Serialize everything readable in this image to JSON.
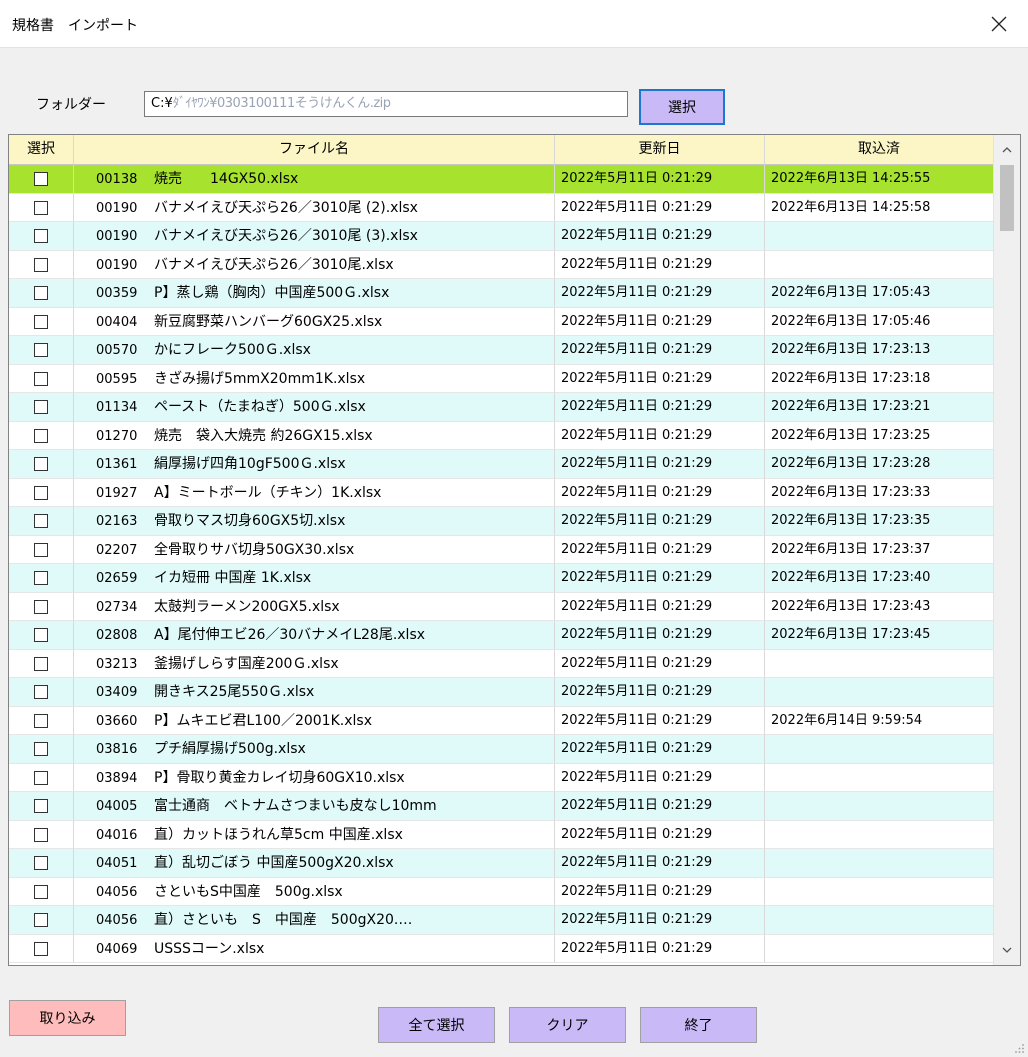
{
  "window": {
    "title": "規格書　インポート"
  },
  "folder": {
    "label": "フォルダー",
    "value_prefix": "C:¥",
    "value_rest": "ﾀﾞｲﾔﾜﾝ¥0303100111そうけんくん.zip",
    "select_label": "選択"
  },
  "grid": {
    "columns": [
      "選択",
      "ファイル名",
      "更新日",
      "取込済"
    ],
    "rows": [
      {
        "code": "00138",
        "name": "焼売　　14GX50.xlsx",
        "updated": "2022年5月11日  0:21:29",
        "imported": "2022年6月13日  14:25:55",
        "style": "sel"
      },
      {
        "code": "00190",
        "name": "バナメイえび天ぷら26／3010尾 (2).xlsx",
        "updated": "2022年5月11日  0:21:29",
        "imported": "2022年6月13日  14:25:58",
        "style": "white"
      },
      {
        "code": "00190",
        "name": "バナメイえび天ぷら26／3010尾 (3).xlsx",
        "updated": "2022年5月11日  0:21:29",
        "imported": "",
        "style": "alt"
      },
      {
        "code": "00190",
        "name": "バナメイえび天ぷら26／3010尾.xlsx",
        "updated": "2022年5月11日  0:21:29",
        "imported": "",
        "style": "white"
      },
      {
        "code": "00359",
        "name": "P】蒸し鶏（胸肉）中国産500Ｇ.xlsx",
        "updated": "2022年5月11日  0:21:29",
        "imported": "2022年6月13日  17:05:43",
        "style": "alt"
      },
      {
        "code": "00404",
        "name": "新豆腐野菜ハンバーグ60GX25.xlsx",
        "updated": "2022年5月11日  0:21:29",
        "imported": "2022年6月13日  17:05:46",
        "style": "white"
      },
      {
        "code": "00570",
        "name": "かにフレーク500Ｇ.xlsx",
        "updated": "2022年5月11日  0:21:29",
        "imported": "2022年6月13日  17:23:13",
        "style": "alt"
      },
      {
        "code": "00595",
        "name": "きざみ揚げ5mmX20mm1K.xlsx",
        "updated": "2022年5月11日  0:21:29",
        "imported": "2022年6月13日  17:23:18",
        "style": "white"
      },
      {
        "code": "01134",
        "name": "ペースト（たまねぎ）500Ｇ.xlsx",
        "updated": "2022年5月11日  0:21:29",
        "imported": "2022年6月13日  17:23:21",
        "style": "alt"
      },
      {
        "code": "01270",
        "name": "焼売　袋入大焼売 約26GX15.xlsx",
        "updated": "2022年5月11日  0:21:29",
        "imported": "2022年6月13日  17:23:25",
        "style": "white"
      },
      {
        "code": "01361",
        "name": "絹厚揚げ四角10gF500Ｇ.xlsx",
        "updated": "2022年5月11日  0:21:29",
        "imported": "2022年6月13日  17:23:28",
        "style": "alt"
      },
      {
        "code": "01927",
        "name": "A】ミートボール（チキン）1K.xlsx",
        "updated": "2022年5月11日  0:21:29",
        "imported": "2022年6月13日  17:23:33",
        "style": "white"
      },
      {
        "code": "02163",
        "name": "骨取りマス切身60GX5切.xlsx",
        "updated": "2022年5月11日  0:21:29",
        "imported": "2022年6月13日  17:23:35",
        "style": "alt"
      },
      {
        "code": "02207",
        "name": "全骨取りサバ切身50GX30.xlsx",
        "updated": "2022年5月11日  0:21:29",
        "imported": "2022年6月13日  17:23:37",
        "style": "white"
      },
      {
        "code": "02659",
        "name": "イカ短冊 中国産 1K.xlsx",
        "updated": "2022年5月11日  0:21:29",
        "imported": "2022年6月13日  17:23:40",
        "style": "alt"
      },
      {
        "code": "02734",
        "name": "太鼓判ラーメン200GX5.xlsx",
        "updated": "2022年5月11日  0:21:29",
        "imported": "2022年6月13日  17:23:43",
        "style": "white"
      },
      {
        "code": "02808",
        "name": "A】尾付伸エビ26／30バナメイL28尾.xlsx",
        "updated": "2022年5月11日  0:21:29",
        "imported": "2022年6月13日  17:23:45",
        "style": "alt"
      },
      {
        "code": "03213",
        "name": "釜揚げしらす国産200Ｇ.xlsx",
        "updated": "2022年5月11日  0:21:29",
        "imported": "",
        "style": "white"
      },
      {
        "code": "03409",
        "name": "開きキス25尾550Ｇ.xlsx",
        "updated": "2022年5月11日  0:21:29",
        "imported": "",
        "style": "alt"
      },
      {
        "code": "03660",
        "name": "P】ムキエビ君L100／2001K.xlsx",
        "updated": "2022年5月11日  0:21:29",
        "imported": "2022年6月14日  9:59:54",
        "style": "white"
      },
      {
        "code": "03816",
        "name": "プチ絹厚揚げ500g.xlsx",
        "updated": "2022年5月11日  0:21:29",
        "imported": "",
        "style": "alt"
      },
      {
        "code": "03894",
        "name": "P】骨取り黄金カレイ切身60GX10.xlsx",
        "updated": "2022年5月11日  0:21:29",
        "imported": "",
        "style": "white"
      },
      {
        "code": "04005",
        "name": "富士通商　ベトナムさつまいも皮なし10mm",
        "updated": "2022年5月11日  0:21:29",
        "imported": "",
        "style": "alt"
      },
      {
        "code": "04016",
        "name": "直）カットほうれん草5cm 中国産.xlsx",
        "updated": "2022年5月11日  0:21:29",
        "imported": "",
        "style": "white"
      },
      {
        "code": "04051",
        "name": "直）乱切ごぼう 中国産500gX20.xlsx",
        "updated": "2022年5月11日  0:21:29",
        "imported": "",
        "style": "alt"
      },
      {
        "code": "04056",
        "name": "さといもS中国産　500g.xlsx",
        "updated": "2022年5月11日  0:21:29",
        "imported": "",
        "style": "white"
      },
      {
        "code": "04056",
        "name": "直）さといも　S　中国産　500gX20.…",
        "updated": "2022年5月11日  0:21:29",
        "imported": "",
        "style": "alt"
      },
      {
        "code": "04069",
        "name": "USSSコーン.xlsx",
        "updated": "2022年5月11日  0:21:29",
        "imported": "",
        "style": "white"
      }
    ]
  },
  "buttons": {
    "import": "取り込み",
    "select_all": "全て選択",
    "clear": "クリア",
    "exit": "終了"
  },
  "icons": {
    "close": "close-icon",
    "scroll_up": "chevron-up-icon",
    "scroll_down": "chevron-down-icon"
  },
  "colors": {
    "selected_row": "#a6e22e",
    "alt_row": "#e0fafa",
    "header": "#fcf6c7",
    "button_purple": "#c9baf7",
    "button_pink": "#ffbcbc"
  }
}
